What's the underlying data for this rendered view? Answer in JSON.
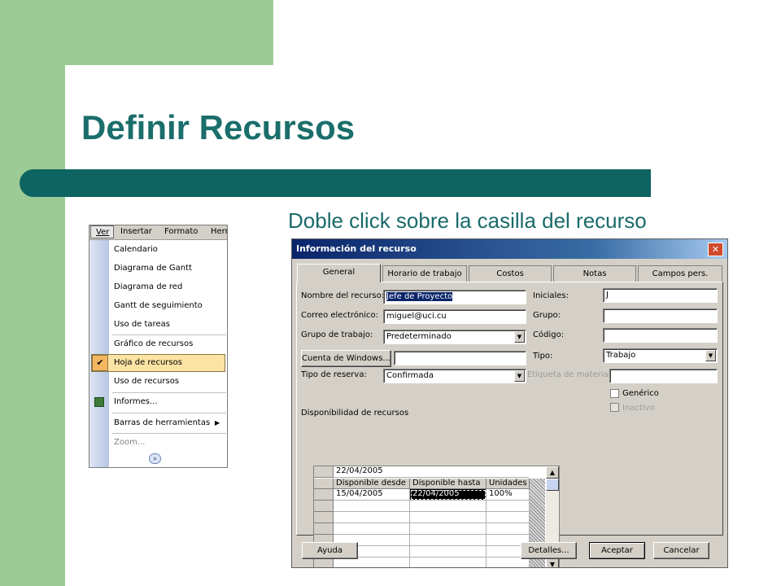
{
  "slide": {
    "title": "Definir Recursos",
    "subtitle": "Doble click sobre la casilla del recurso"
  },
  "menu": {
    "bar": [
      "Ver",
      "Insertar",
      "Formato",
      "Herr"
    ],
    "items": [
      "Calendario",
      "Diagrama de Gantt",
      "Diagrama de red",
      "Gantt de seguimiento",
      "Uso de tareas",
      "Gráfico de recursos",
      "Hoja de recursos",
      "Uso de recursos",
      "Informes...",
      "Barras de herramientas",
      "Zoom..."
    ],
    "checked_item": "Hoja de recursos",
    "check_glyph": "✔",
    "submenu_glyph": "▶",
    "expand_glyph": "»",
    "icons": {
      "informes": "reports-icon",
      "check": "check-icon",
      "expand": "expand-chevron-icon"
    }
  },
  "dialog": {
    "title": "Información del recurso",
    "close_glyph": "✕",
    "tabs": [
      "General",
      "Horario de trabajo",
      "Costos",
      "Notas",
      "Campos pers."
    ],
    "active_tab": "General",
    "labels": {
      "nombre": "Nombre del recurso:",
      "correo": "Correo electrónico:",
      "grupo_trabajo": "Grupo de trabajo:",
      "tipo_reserva": "Tipo de reserva:",
      "iniciales": "Iniciales:",
      "grupo": "Grupo:",
      "codigo": "Código:",
      "tipo": "Tipo:",
      "etiqueta": "Etiqueta de material:",
      "disponibilidad": "Disponibilidad de recursos"
    },
    "values": {
      "nombre": "Jefe de Proyecto",
      "correo": "miguel@uci.cu",
      "grupo_trabajo": "Predeterminado",
      "tipo_reserva": "Confirmada",
      "iniciales": "J",
      "grupo": "",
      "codigo": "",
      "tipo": "Trabajo",
      "etiqueta": "",
      "cuenta_windows": ""
    },
    "checkboxes": {
      "generico": "Genérico",
      "inactivo": "Inactivo"
    },
    "cuenta_button": "Cuenta de Windows...",
    "grid": {
      "edit_value": "22/04/2005",
      "columns": [
        "Disponible desde",
        "Disponible hasta",
        "Unidades"
      ],
      "rows": [
        [
          "15/04/2005",
          "22/04/2005",
          "100%"
        ]
      ],
      "scroll_up": "▲",
      "scroll_down": "▼"
    },
    "buttons": {
      "ayuda": "Ayuda",
      "detalles": "Detalles...",
      "aceptar": "Aceptar",
      "cancelar": "Cancelar"
    },
    "dropdown_glyph": "▼"
  }
}
